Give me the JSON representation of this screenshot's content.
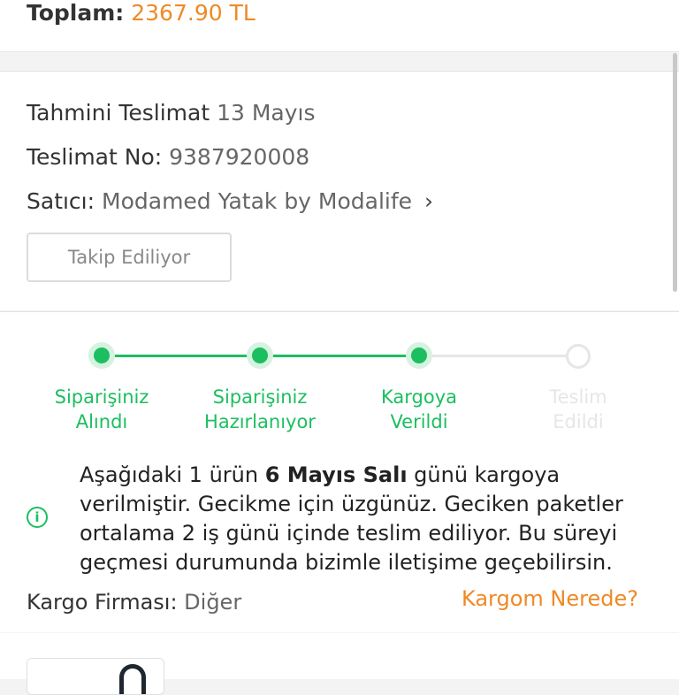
{
  "summary": {
    "total_label": "Toplam:",
    "total_value": "2367.90 TL"
  },
  "delivery": {
    "estimate_label": "Tahmini Teslimat",
    "estimate_value": "13 Mayıs",
    "number_label": "Teslimat No:",
    "number_value": "9387920008",
    "seller_label": "Satıcı:",
    "seller_value": "Modamed Yatak by Modalife",
    "seller_chevron": "›",
    "follow_button": "Takip Ediliyor"
  },
  "tracking": {
    "steps": [
      {
        "line1": "Siparişiniz",
        "line2": "Alındı",
        "state": "done"
      },
      {
        "line1": "Siparişiniz",
        "line2": "Hazırlanıyor",
        "state": "done"
      },
      {
        "line1": "Kargoya",
        "line2": "Verildi",
        "state": "done"
      },
      {
        "line1": "Teslim",
        "line2": "Edildi",
        "state": "pending"
      }
    ],
    "message": {
      "part1": "Aşağıdaki 1 ürün ",
      "bold": "6 Mayıs Salı",
      "part2": " günü kargoya verilmiştir. Gecikme için üzgünüz. Geciken paketler ortalama 2 iş günü içinde teslim ediliyor. Bu süreyi geçmesi durumunda bizimle iletişime geçebilirsin."
    },
    "info_icon_glyph": "i",
    "carrier_label": "Kargo Firması:",
    "carrier_value": "Diğer",
    "where_link": "Kargom Nerede?"
  },
  "colors": {
    "accent": "#ee8a25",
    "success": "#1bbf5f",
    "pending": "#e6e6e6"
  },
  "icons": {
    "info": "info-circle-icon",
    "chevron": "chevron-right-icon"
  }
}
